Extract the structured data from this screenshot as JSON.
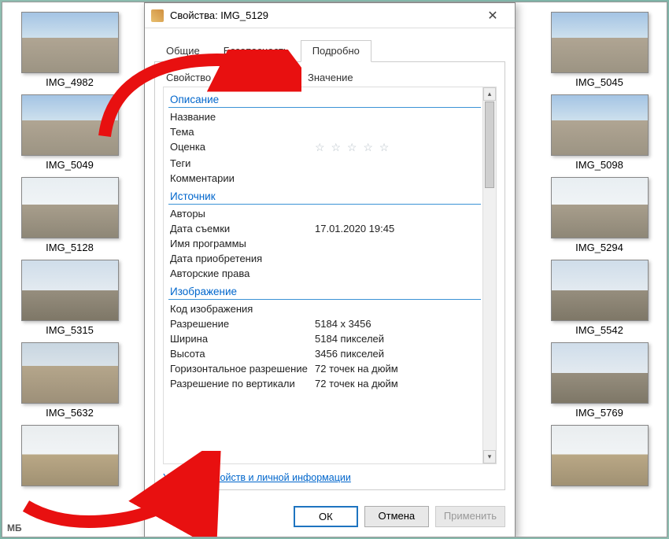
{
  "background_label": "МБ",
  "thumbs_left": [
    {
      "label": "IMG_4982",
      "cls": "sky"
    },
    {
      "label": "IMG_5049",
      "cls": "sky"
    },
    {
      "label": "IMG_5128",
      "cls": "sky2"
    },
    {
      "label": "IMG_5315",
      "cls": "city"
    },
    {
      "label": "IMG_5632",
      "cls": "dome"
    },
    {
      "label": "",
      "cls": "castle"
    }
  ],
  "thumbs_right": [
    {
      "label": "IMG_5045",
      "cls": "sky"
    },
    {
      "label": "IMG_5098",
      "cls": "sky"
    },
    {
      "label": "IMG_5294",
      "cls": "sky2"
    },
    {
      "label": "IMG_5542",
      "cls": "city"
    },
    {
      "label": "IMG_5769",
      "cls": "city"
    },
    {
      "label": "",
      "cls": "castle"
    }
  ],
  "dialog": {
    "title": "Свойства: IMG_5129",
    "tabs": [
      "Общие",
      "Безопасность",
      "Подробно"
    ],
    "active_tab": 2,
    "header_prop": "Свойство",
    "header_val": "Значение",
    "sections": [
      {
        "title": "Описание",
        "rows": [
          {
            "k": "Название",
            "v": ""
          },
          {
            "k": "Тема",
            "v": ""
          },
          {
            "k": "Оценка",
            "v": "",
            "stars": true
          },
          {
            "k": "Теги",
            "v": ""
          },
          {
            "k": "Комментарии",
            "v": ""
          }
        ]
      },
      {
        "title": "Источник",
        "rows": [
          {
            "k": "Авторы",
            "v": ""
          },
          {
            "k": "Дата съемки",
            "v": "17.01.2020 19:45"
          },
          {
            "k": "Имя программы",
            "v": ""
          },
          {
            "k": "Дата приобретения",
            "v": ""
          },
          {
            "k": "Авторские права",
            "v": ""
          }
        ]
      },
      {
        "title": "Изображение",
        "rows": [
          {
            "k": "Код изображения",
            "v": ""
          },
          {
            "k": "Разрешение",
            "v": "5184 x 3456"
          },
          {
            "k": "Ширина",
            "v": "5184 пикселей"
          },
          {
            "k": "Высота",
            "v": "3456 пикселей"
          },
          {
            "k": "Горизонтальное разрешение",
            "v": "72 точек на дюйм"
          },
          {
            "k": "Разрешение по вертикали",
            "v": "72 точек на дюйм"
          }
        ]
      }
    ],
    "link": "Удаление свойств и личной информации",
    "buttons": {
      "ok": "ОК",
      "cancel": "Отмена",
      "apply": "Применить"
    }
  }
}
